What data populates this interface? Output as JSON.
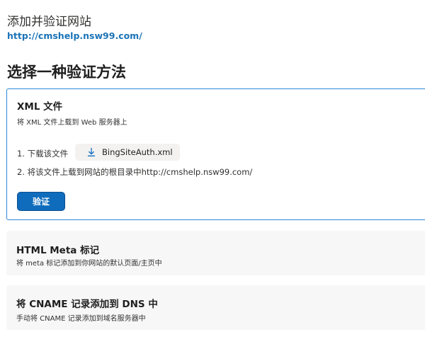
{
  "header": {
    "title": "添加并验证网站",
    "site_url": "http://cmshelp.nsw99.com/"
  },
  "methods_title": "选择一种验证方法",
  "xml_card": {
    "title": "XML 文件",
    "description": "将 XML 文件上载到 Web 服务器上",
    "step1_label": "1. 下载该文件",
    "download_button_label": "BingSiteAuth.xml",
    "step2_label": "2. 将该文件上载到网站的根目录中http://cmshelp.nsw99.com/",
    "verify_button_label": "验证"
  },
  "meta_card": {
    "title": "HTML Meta 标记",
    "description": "将 meta 标记添加到你网站的默认页面/主页中"
  },
  "cname_card": {
    "title": "将 CNAME 记录添加到 DNS 中",
    "description": "手动将 CNAME 记录添加到域名服务器中"
  },
  "colors": {
    "link": "#1a73b8",
    "accent": "#0f6cbd",
    "selected_border": "#2b88d8",
    "card_bg": "#f7f7f7"
  },
  "icons": {
    "download": "download-icon"
  }
}
